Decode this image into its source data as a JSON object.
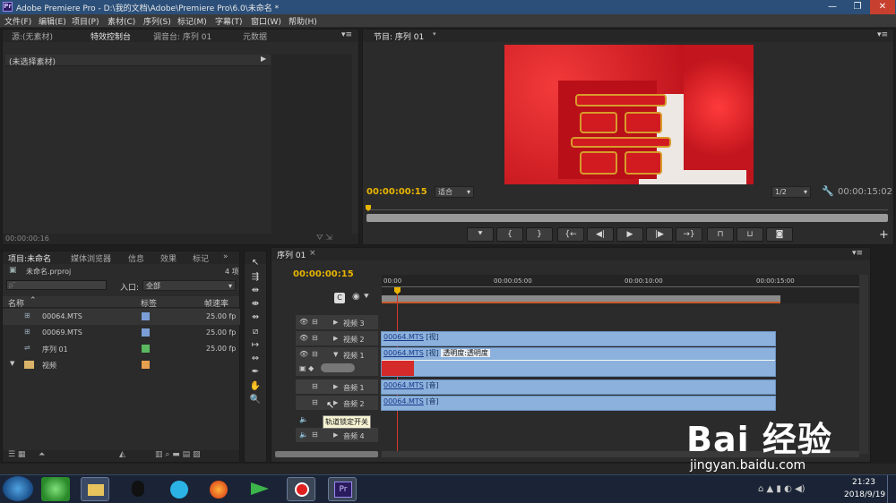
{
  "window": {
    "title": "Adobe Premiere Pro - D:\\我的文档\\Adobe\\Premiere Pro\\6.0\\未命名 *",
    "logo": "Pr"
  },
  "menu": [
    "文件(F)",
    "编辑(E)",
    "项目(P)",
    "素材(C)",
    "序列(S)",
    "标记(M)",
    "字幕(T)",
    "窗口(W)",
    "帮助(H)"
  ],
  "source_panel": {
    "tabs": [
      "源:(无素材)",
      "特效控制台",
      "调音台: 序列 01",
      "元数据"
    ],
    "no_clip": "(未选择素材)",
    "timecode": "00:00:00:16"
  },
  "program_monitor": {
    "tab": "节目: 序列 01",
    "timecode": "00:00:00:15",
    "fit": "适合",
    "resolution": "1/2",
    "duration": "00:00:15:02"
  },
  "project_panel": {
    "tabs": [
      "项目:未命名",
      "媒体浏览器",
      "信息",
      "效果",
      "标记"
    ],
    "project_file": "未命名.prproj",
    "item_count": "4 项",
    "search_placeholder": "ρ˜",
    "inpoint_label": "入口:",
    "inpoint_value": "全部",
    "columns": {
      "name": "名称",
      "label": "标签",
      "framerate": "帧速率"
    },
    "items": [
      {
        "name": "00064.MTS",
        "color": "#7a9fd6",
        "framerate": "25.00 fp"
      },
      {
        "name": "00069.MTS",
        "color": "#7a9fd6",
        "framerate": "25.00 fp"
      },
      {
        "name": "序列 01",
        "color": "#59b860",
        "framerate": "25.00 fp"
      },
      {
        "name": "视频",
        "color": "#e7a04e",
        "framerate": ""
      }
    ]
  },
  "timeline": {
    "tab": "序列 01",
    "timecode": "00:00:00:15",
    "ruler": [
      "00:00",
      "00:00:05:00",
      "00:00:10:00",
      "00:00:15:00"
    ],
    "tracks": [
      {
        "name": "视频 3"
      },
      {
        "name": "视频 2"
      },
      {
        "name": "视频 1"
      },
      {
        "name": "音频 1"
      },
      {
        "name": "音频 2"
      },
      {
        "name": "音频 4"
      }
    ],
    "clips": {
      "video2": {
        "link": "00064.MTS",
        "tag": "[视]"
      },
      "video1": {
        "link": "00064.MTS",
        "tag": "[视]",
        "effect": "透明度:透明度"
      },
      "audio1": {
        "link": "00064.MTS",
        "tag": "[音]"
      },
      "audio2": {
        "link": "00064.MTS",
        "tag": "[音]"
      }
    },
    "tooltip": "轨道锁定开关"
  },
  "taskbar": {
    "time": "21:23",
    "date": "2018/9/19"
  },
  "watermark": {
    "brand": "Bai 经验",
    "url": "jingyan.baidu.com"
  }
}
